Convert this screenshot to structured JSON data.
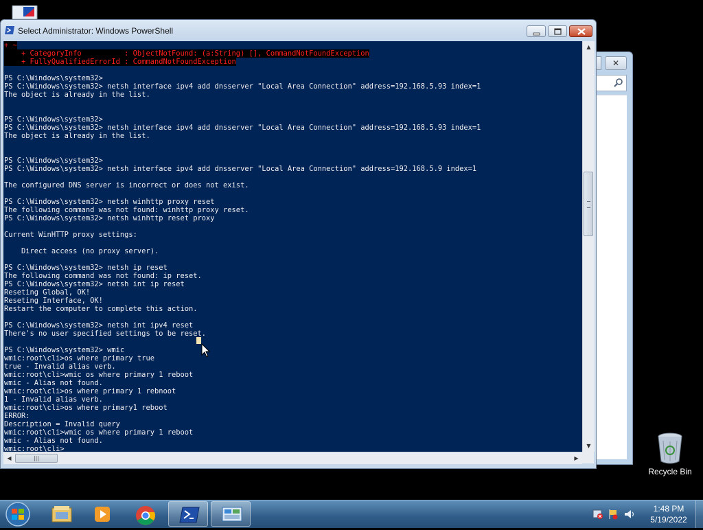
{
  "window": {
    "title": "Select Administrator: Windows PowerShell",
    "icon": "powershell-icon",
    "buttons": [
      "minimize-icon",
      "maximize-icon",
      "close-icon"
    ]
  },
  "console": {
    "background": "#012456",
    "foreground": "#eeedf0",
    "error_color": "#ff2020",
    "lines": [
      {
        "text": "+ ~",
        "type": "err"
      },
      {
        "text": "    + CategoryInfo          : ObjectNotFound: (a:String) [], CommandNotFoundException",
        "type": "err"
      },
      {
        "text": "    + FullyQualifiedErrorId : CommandNotFoundException",
        "type": "err"
      },
      {
        "text": "",
        "type": "out"
      },
      {
        "text": "PS C:\\Windows\\system32>",
        "type": "out"
      },
      {
        "text": "PS C:\\Windows\\system32> netsh interface ipv4 add dnsserver \"Local Area Connection\" address=192.168.5.93 index=1",
        "type": "out"
      },
      {
        "text": "The object is already in the list.",
        "type": "out"
      },
      {
        "text": "",
        "type": "out"
      },
      {
        "text": "",
        "type": "out"
      },
      {
        "text": "PS C:\\Windows\\system32>",
        "type": "out"
      },
      {
        "text": "PS C:\\Windows\\system32> netsh interface ipv4 add dnsserver \"Local Area Connection\" address=192.168.5.93 index=1",
        "type": "out"
      },
      {
        "text": "The object is already in the list.",
        "type": "out"
      },
      {
        "text": "",
        "type": "out"
      },
      {
        "text": "",
        "type": "out"
      },
      {
        "text": "PS C:\\Windows\\system32>",
        "type": "out"
      },
      {
        "text": "PS C:\\Windows\\system32> netsh interface ipv4 add dnsserver \"Local Area Connection\" address=192.168.5.9 index=1",
        "type": "out"
      },
      {
        "text": "",
        "type": "out"
      },
      {
        "text": "The configured DNS server is incorrect or does not exist.",
        "type": "out"
      },
      {
        "text": "",
        "type": "out"
      },
      {
        "text": "PS C:\\Windows\\system32> netsh winhttp proxy reset",
        "type": "out"
      },
      {
        "text": "The following command was not found: winhttp proxy reset.",
        "type": "out"
      },
      {
        "text": "PS C:\\Windows\\system32> netsh winhttp reset proxy",
        "type": "out"
      },
      {
        "text": "",
        "type": "out"
      },
      {
        "text": "Current WinHTTP proxy settings:",
        "type": "out"
      },
      {
        "text": "",
        "type": "out"
      },
      {
        "text": "    Direct access (no proxy server).",
        "type": "out"
      },
      {
        "text": "",
        "type": "out"
      },
      {
        "text": "PS C:\\Windows\\system32> netsh ip reset",
        "type": "out"
      },
      {
        "text": "The following command was not found: ip reset.",
        "type": "out"
      },
      {
        "text": "PS C:\\Windows\\system32> netsh int ip reset",
        "type": "out"
      },
      {
        "text": "Reseting Global, OK!",
        "type": "out"
      },
      {
        "text": "Reseting Interface, OK!",
        "type": "out"
      },
      {
        "text": "Restart the computer to complete this action.",
        "type": "out"
      },
      {
        "text": "",
        "type": "out"
      },
      {
        "text": "PS C:\\Windows\\system32> netsh int ipv4 reset",
        "type": "out"
      },
      {
        "text": "There's no user specified settings to be reset.",
        "type": "out"
      },
      {
        "text": "",
        "type": "out"
      },
      {
        "text": "PS C:\\Windows\\system32> wmic",
        "type": "out"
      },
      {
        "text": "wmic:root\\cli>os where primary true",
        "type": "out"
      },
      {
        "text": "true - Invalid alias verb.",
        "type": "out"
      },
      {
        "text": "wmic:root\\cli>wmic os where primary 1 reboot",
        "type": "out"
      },
      {
        "text": "wmic - Alias not found.",
        "type": "out"
      },
      {
        "text": "wmic:root\\cli>os where primary 1 rebnoot",
        "type": "out"
      },
      {
        "text": "1 - Invalid alias verb.",
        "type": "out"
      },
      {
        "text": "wmic:root\\cli>os where primary1 reboot",
        "type": "out"
      },
      {
        "text": "ERROR:",
        "type": "out"
      },
      {
        "text": "Description = Invalid query",
        "type": "out"
      },
      {
        "text": "wmic:root\\cli>wmic os where primary 1 reboot",
        "type": "out"
      },
      {
        "text": "wmic - Alias not found.",
        "type": "out"
      },
      {
        "text": "wmic:root\\cli>",
        "type": "out"
      }
    ]
  },
  "desktop": {
    "recycle_bin_label": "Recycle Bin"
  },
  "taskbar": {
    "items": [
      "start-button",
      "explorer-icon",
      "media-player-icon",
      "chrome-icon",
      "powershell-icon",
      "control-panel-icon"
    ],
    "active_item": "powershell-icon",
    "tray_icons": [
      "network-error-icon",
      "flag-icon",
      "volume-icon"
    ],
    "time": "1:48 PM",
    "date": "5/19/2022"
  }
}
